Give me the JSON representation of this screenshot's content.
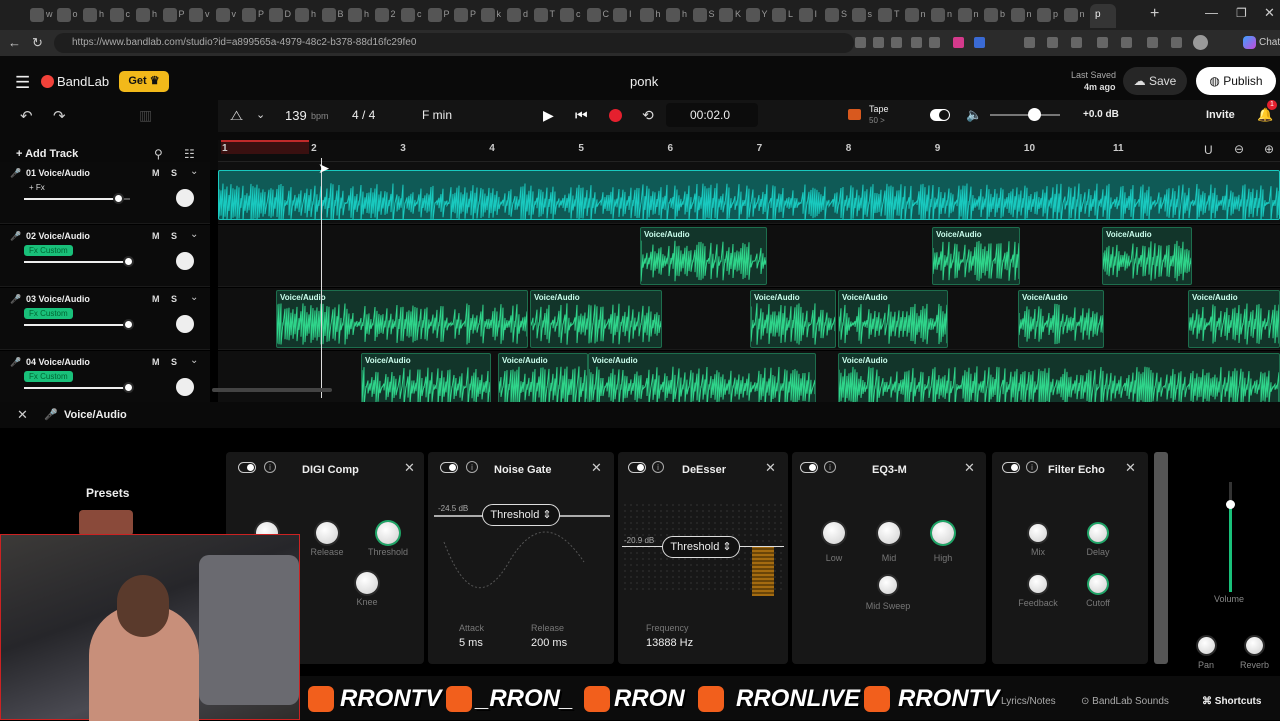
{
  "browser": {
    "url": "https://www.bandlab.com/studio?id=a899565a-4979-48c2-b378-88d16fc29fe0",
    "tab_titles": [
      "w",
      "o",
      "h",
      "c",
      "h",
      "P",
      "v",
      "v",
      "P",
      "D",
      "h",
      "B",
      "h",
      "2",
      "c",
      "P",
      "P",
      "k",
      "d",
      "T",
      "c",
      "C",
      "I",
      "h",
      "h",
      "S",
      "K",
      "Y",
      "L",
      "I",
      "S",
      "s",
      "T",
      "n",
      "n",
      "n",
      "b",
      "n",
      "p",
      "n"
    ],
    "active_tab_title": "p"
  },
  "app": {
    "logo": "BandLab",
    "get_label": "Get",
    "project_title": "ponk",
    "last_saved_label": "Last Saved",
    "last_saved_time": "4m ago",
    "save_label": "Save",
    "publish_label": "Publish",
    "invite_label": "Invite",
    "notification_count": "1"
  },
  "transport": {
    "tempo": "139",
    "tempo_unit": "bpm",
    "time_signature": "4 / 4",
    "key": "F min",
    "time": "00:02.0",
    "tape_label": "Tape",
    "tape_value": "50 >",
    "master_db": "+0.0 dB"
  },
  "tracks_panel": {
    "add_track_label": "Add Track",
    "ruler": [
      "1",
      "2",
      "3",
      "4",
      "5",
      "6",
      "7",
      "8",
      "9",
      "10",
      "11"
    ],
    "tracks": [
      {
        "name": "01 Voice/Audio",
        "badge": "+ Fx",
        "mute": "M",
        "solo": "S"
      },
      {
        "name": "02 Voice/Audio",
        "badge": "Fx Custom",
        "mute": "M",
        "solo": "S"
      },
      {
        "name": "03 Voice/Audio",
        "badge": "Fx Custom",
        "mute": "M",
        "solo": "S"
      },
      {
        "name": "04 Voice/Audio",
        "badge": "Fx Custom",
        "mute": "M",
        "solo": "S"
      }
    ],
    "clip_label": "Voice/Audio"
  },
  "fx": {
    "bar_title": "Voice/Audio",
    "presets_label": "Presets",
    "digi": {
      "title": "DIGI Comp",
      "k_release": "Release",
      "k_threshold": "Threshold",
      "k_knee": "Knee"
    },
    "gate": {
      "title": "Noise Gate",
      "db": "-24.5 dB",
      "threshold": "Threshold",
      "attack_label": "Attack",
      "attack": "5 ms",
      "release_label": "Release",
      "release": "200 ms"
    },
    "deesser": {
      "title": "DeEsser",
      "db": "-20.9 dB",
      "threshold": "Threshold",
      "freq_label": "Frequency",
      "freq": "13888 Hz"
    },
    "eq": {
      "title": "EQ3-M",
      "low": "Low",
      "mid": "Mid",
      "high": "High",
      "sweep": "Mid Sweep"
    },
    "echo": {
      "title": "Filter Echo",
      "mix": "Mix",
      "delay": "Delay",
      "feedback": "Feedback",
      "cutoff": "Cutoff"
    },
    "volume_label": "Volume",
    "pan_label": "Pan",
    "reverb_label": "Reverb"
  },
  "footer": {
    "lyrics": "Lyrics/Notes",
    "sounds": "BandLab Sounds",
    "shortcuts": "Shortcuts"
  },
  "stream_banner": {
    "twitter": "RRONTV",
    "tiktok": "_RRON_",
    "kick": "RRON",
    "youtube": "RRONLIVE",
    "instagram": "RRONTV"
  },
  "colors": {
    "accent_green": "#19c07a",
    "cyan_track": "#19c9bf",
    "record_red": "#e5202e",
    "brand_red": "#f2423a",
    "get_yellow": "#f2b91a"
  }
}
